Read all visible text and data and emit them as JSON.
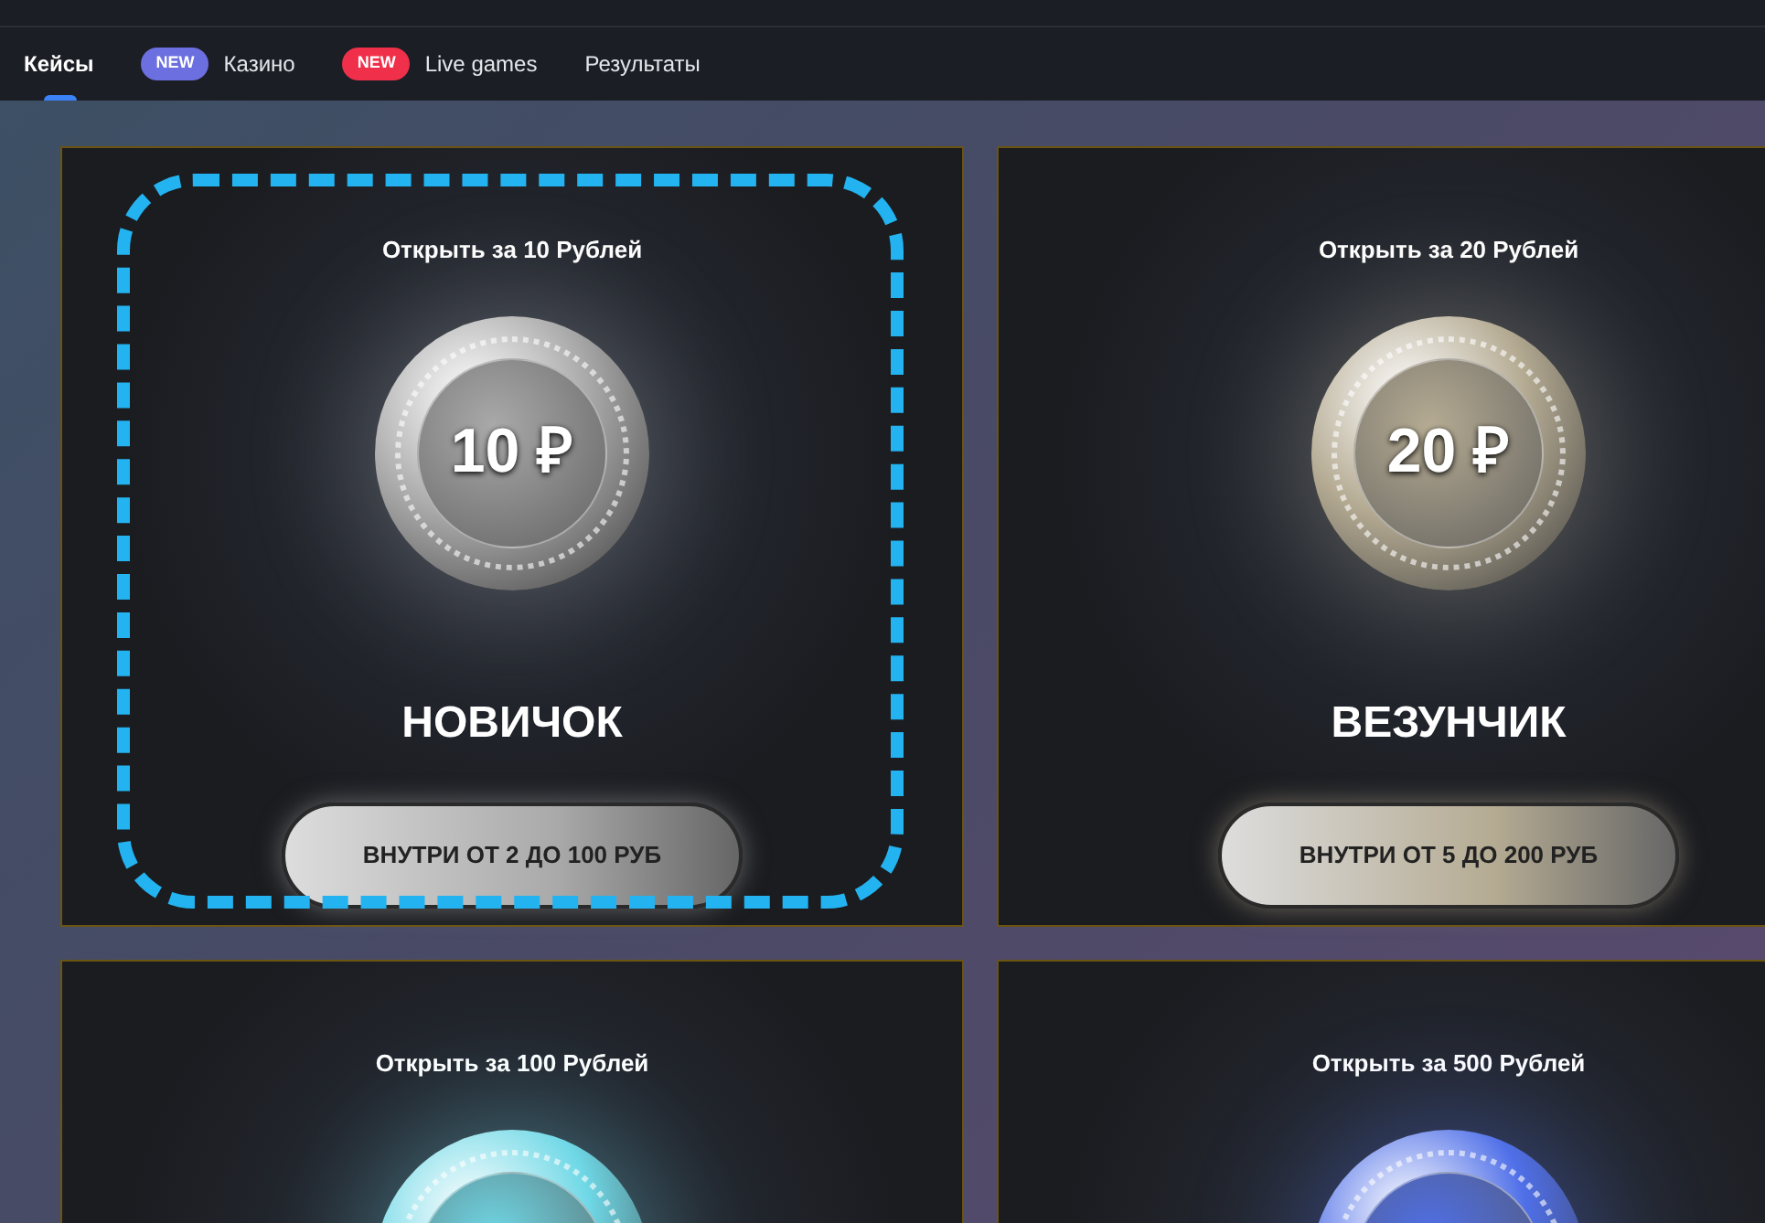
{
  "nav": {
    "tabs": [
      {
        "label": "Кейсы",
        "selected": true
      },
      {
        "label": "Казино",
        "selected": false,
        "badge": {
          "text": "NEW",
          "color": "#6b6fe0"
        }
      },
      {
        "label": "Live games",
        "selected": false,
        "badge": {
          "text": "NEW",
          "color": "#f0304a"
        }
      },
      {
        "label": "Результаты",
        "selected": false
      }
    ]
  },
  "cases": [
    {
      "price": "Открыть за 10 Рублей",
      "coin_value": "10 ₽",
      "name": "НОВИЧОК",
      "button": "ВНУТРИ ОТ 2 ДО 100  РУБ",
      "color": "#a9a9a9",
      "selected": true
    },
    {
      "price": "Открыть за 20 Рублей",
      "coin_value": "20 ₽",
      "name": "ВЕЗУНЧИК",
      "button": "ВНУТРИ ОТ 5 ДО 200  РУБ",
      "color": "#b5ab93",
      "selected": false
    },
    {
      "price": "Открыть за 100 Рублей",
      "color": "#6fd8e6",
      "selected": false
    },
    {
      "price": "Открыть за 500 Рублей",
      "color": "#4f6fe8",
      "selected": false
    }
  ]
}
